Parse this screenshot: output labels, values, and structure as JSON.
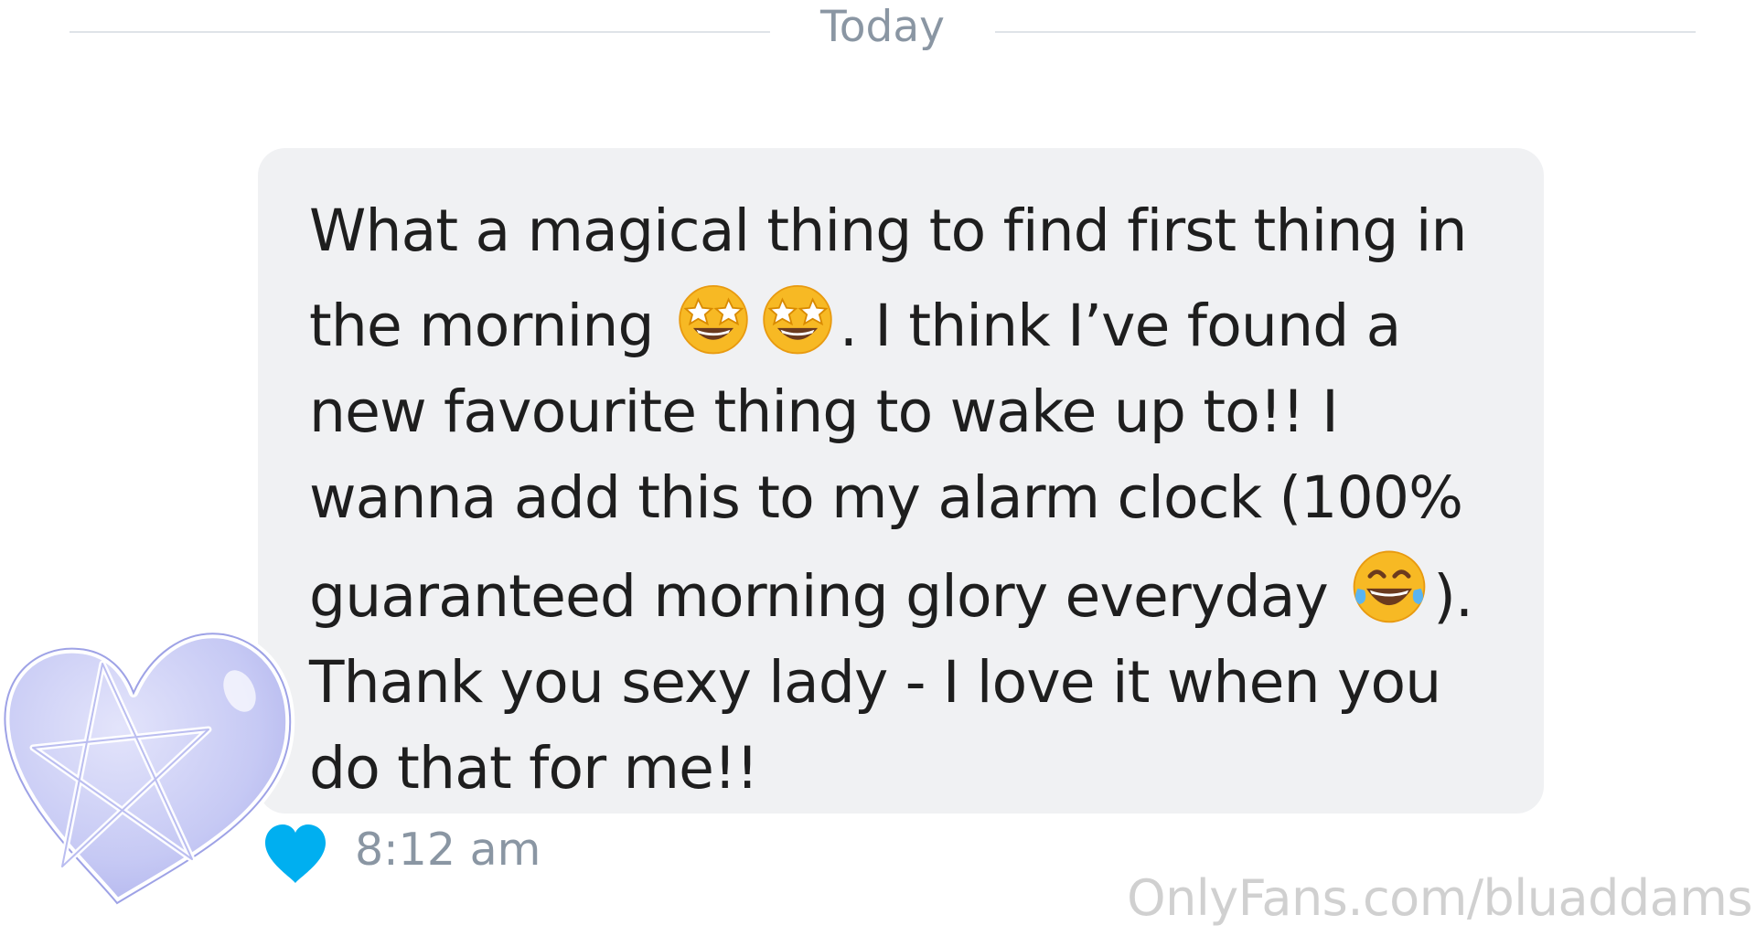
{
  "conversation": {
    "date_separator": "Today"
  },
  "message": {
    "lines": [
      [
        "What a magical thing to find first thing in"
      ],
      [
        "the morning ",
        "{star-struck}",
        "{star-struck}",
        ". I think I’ve found a"
      ],
      [
        "new favourite thing to wake up to!! I"
      ],
      [
        "wanna add this to my alarm clock (100%"
      ],
      [
        "guaranteed morning glory everyday ",
        "{laugh}",
        ")."
      ],
      [
        "Thank you sexy lady - I love it when you"
      ],
      [
        "do that for me!!"
      ]
    ],
    "line_1": "What a magical thing to find first thing in",
    "line_2_a": "the morning ",
    "line_2_b": ". I think I’ve found a",
    "line_3": "new favourite thing to wake up to!! I",
    "line_4": "wanna add this to my alarm clock (100%",
    "line_5_a": "guaranteed morning glory everyday ",
    "line_5_b": ").",
    "line_6": "Thank you sexy lady - I love it when you",
    "line_7": "do that for me!!",
    "emojis": [
      "star-struck-emoji",
      "star-struck-emoji",
      "face-with-tears-of-joy-emoji"
    ],
    "time": "8:12 am",
    "liked": true
  },
  "sticker": {
    "icon": "pentagram-heart-sticker",
    "color": "#c9ccf5"
  },
  "watermark": {
    "text": "OnlyFans.com/bluaddams"
  },
  "colors": {
    "bubble_bg": "#f0f1f3",
    "meta_text": "#8a96a3",
    "like_heart": "#00aff0"
  }
}
